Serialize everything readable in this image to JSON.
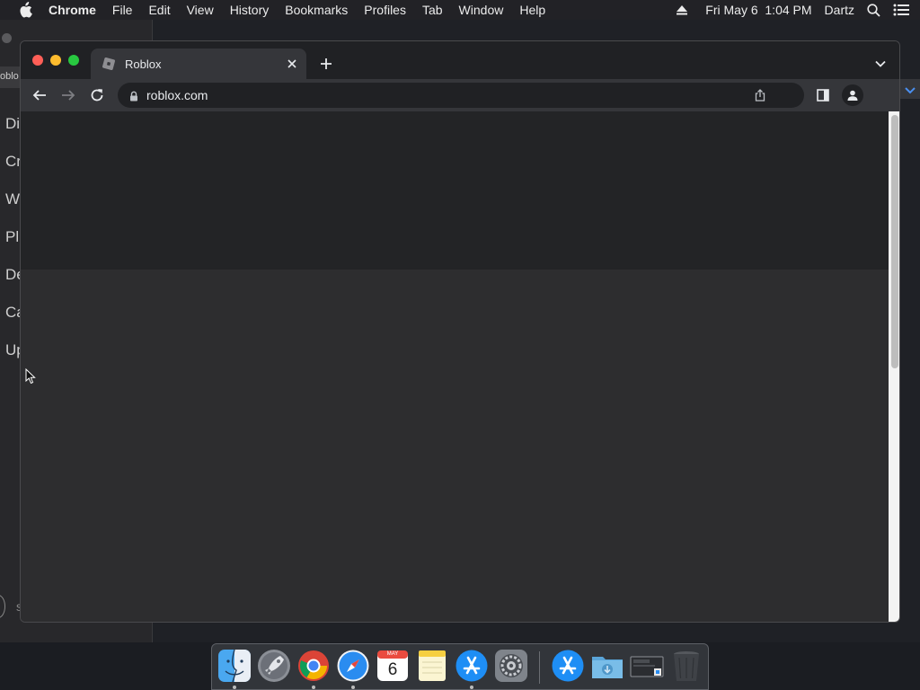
{
  "menubar": {
    "app_name": "Chrome",
    "items": [
      "File",
      "Edit",
      "View",
      "History",
      "Bookmarks",
      "Profiles",
      "Tab",
      "Window",
      "Help"
    ],
    "datetime": "Fri May 6  1:04 PM",
    "user": "Dartz",
    "icons": [
      "apple-icon",
      "eject-icon",
      "spotlight-search-icon",
      "control-center-icon"
    ]
  },
  "background_window": {
    "tab_fragment": "oblo",
    "nav_fragments": [
      "Di",
      "Cr",
      "W",
      "Pl",
      "De",
      "Ca",
      "Up"
    ],
    "bottom_fragment": "s"
  },
  "browser": {
    "tab": {
      "title": "Roblox",
      "favicon": "roblox-icon"
    },
    "omnibox": {
      "url": "roblox.com"
    },
    "colors": {
      "frame": "#202124",
      "toolbar": "#35363a",
      "page_background": "#2d2d2f",
      "page_header": "#232426"
    }
  },
  "dock": {
    "apps": [
      {
        "name": "Finder",
        "running": true
      },
      {
        "name": "Launchpad",
        "running": false
      },
      {
        "name": "Google Chrome",
        "running": true
      },
      {
        "name": "Safari",
        "running": true
      },
      {
        "name": "Calendar",
        "running": false,
        "month": "MAY",
        "day": "6"
      },
      {
        "name": "Notes",
        "running": false
      },
      {
        "name": "App Store",
        "running": true
      },
      {
        "name": "System Preferences",
        "running": false
      },
      {
        "name": "App Store",
        "running": false
      },
      {
        "name": "Downloads",
        "running": false
      },
      {
        "name": "Screen Capture",
        "running": false
      },
      {
        "name": "Trash",
        "running": false
      }
    ]
  }
}
